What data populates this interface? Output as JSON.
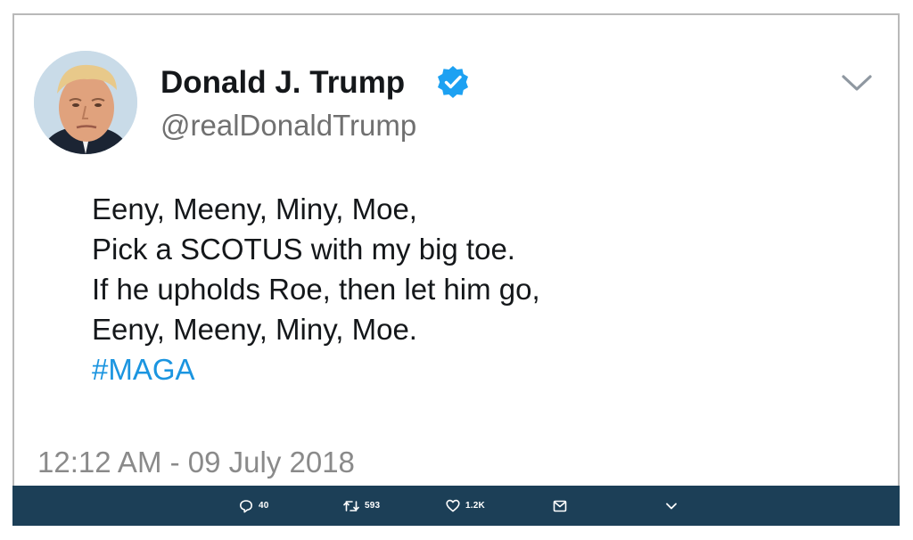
{
  "author": {
    "display_name": "Donald J. Trump",
    "handle": "@realDonaldTrump",
    "verified": true,
    "avatar_icon": "profile-photo"
  },
  "tweet": {
    "lines": [
      "Eeny, Meeny, Miny, Moe,",
      "Pick a SCOTUS with my big toe.",
      "If he upholds Roe, then let him go,",
      "Eeny, Meeny, Miny, Moe."
    ],
    "hashtag": "#MAGA",
    "timestamp": "12:12 AM - 09 July 2018"
  },
  "actions": {
    "replies": "40",
    "retweets": "593",
    "likes": "1.2K"
  },
  "colors": {
    "action_bar": "#1c3f57",
    "hashtag": "#1b95e0",
    "verified": "#1da1f2",
    "timestamp": "#8a8a8a",
    "handle": "#707070"
  }
}
